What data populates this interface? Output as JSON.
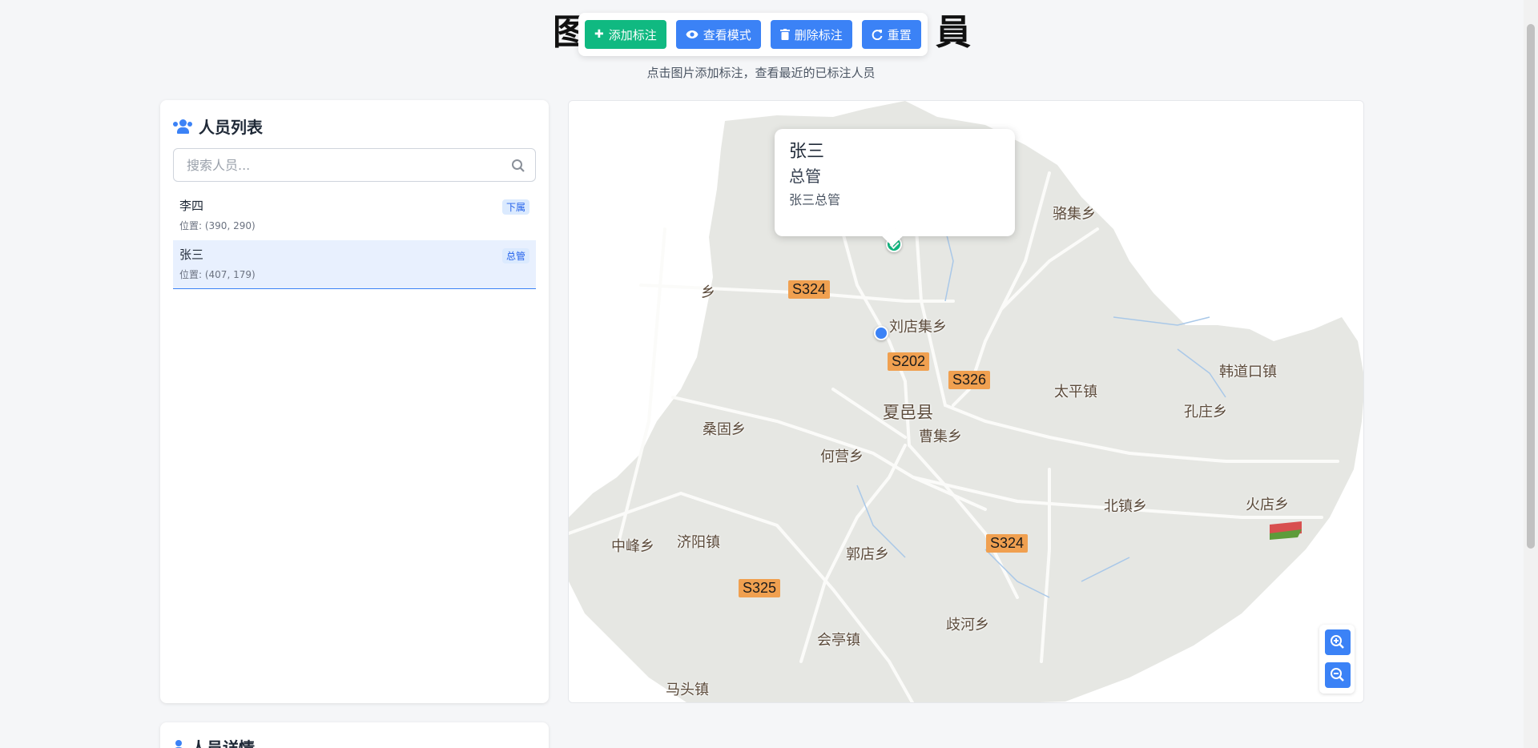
{
  "header": {
    "title_left_char": "图",
    "title_right_char": "員",
    "subtitle": "点击图片添加标注，查看最近的已标注人员",
    "toolbar": {
      "add_label": "添加标注",
      "view_label": "查看模式",
      "delete_label": "删除标注",
      "reset_label": "重置"
    }
  },
  "sidebar": {
    "title": "人员列表",
    "search_placeholder": "搜索人员...",
    "items": [
      {
        "name": "李四",
        "position": "位置: (390, 290)",
        "badge": "下属"
      },
      {
        "name": "张三",
        "position": "位置: (407, 179)",
        "badge": "总管"
      }
    ]
  },
  "details": {
    "title": "人员详情"
  },
  "map": {
    "popup": {
      "name": "张三",
      "role": "总管",
      "description": "张三总管"
    },
    "places": {
      "luoji": "骆集乡",
      "liudianji": "刘店集乡",
      "hanchaokou": "韩道口镇",
      "taiping": "太平镇",
      "kongzhuang": "孔庄乡",
      "xiayi": "夏邑县",
      "caoji": "曹集乡",
      "sanggu": "桑固乡",
      "heying": "何营乡",
      "beizhen": "北镇乡",
      "huodian": "火店乡",
      "zhongfeng": "中峰乡",
      "jiyang": "济阳镇",
      "guodian": "郭店乡",
      "qihe": "歧河乡",
      "huiting": "会亭镇",
      "matou": "马头镇",
      "cut_left": "乡"
    },
    "roads": {
      "s324a": "S324",
      "s202": "S202",
      "s326": "S326",
      "s324b": "S324",
      "s325": "S325"
    }
  },
  "colors": {
    "primary": "#3b82f6",
    "success": "#10b981"
  }
}
